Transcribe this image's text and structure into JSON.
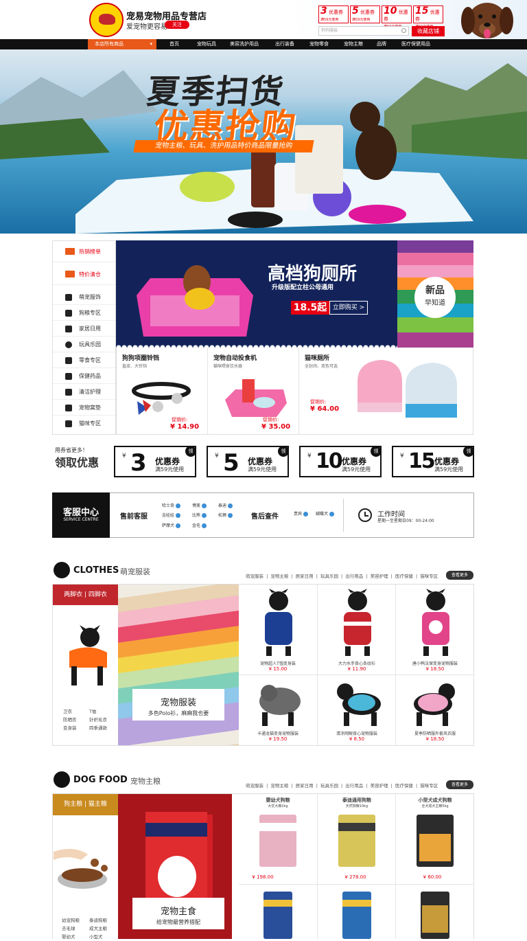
{
  "header": {
    "store_name": "宠易宠物用品专营店",
    "slogan": "爱宠物更容易",
    "follow": "关注",
    "search_placeholder": "狗狗服装",
    "shop_button": "收藏店铺",
    "mini_coupons": [
      {
        "amount": "3",
        "label": "优惠券",
        "cond": "满59元使用"
      },
      {
        "amount": "5",
        "label": "优惠券",
        "cond": "满59元使用"
      },
      {
        "amount": "10",
        "label": "优惠券",
        "cond": "满59元使用"
      },
      {
        "amount": "15",
        "label": "优惠券",
        "cond": "满59元使用"
      }
    ]
  },
  "nav": {
    "all": "本店所有商品",
    "items": [
      "首页",
      "宠物玩具",
      "美容洗护用品",
      "出行装备",
      "宠物零食",
      "宠物主粮",
      "品牌",
      "医疗保健用品"
    ]
  },
  "banner": {
    "title1": "夏季扫货",
    "title2": "优惠抢购",
    "sub": "宠物主粮、玩具、洗护用品特价商品限量抢购"
  },
  "side_menu": [
    {
      "label": "热销榜单",
      "icon": "top-icon"
    },
    {
      "label": "特价清仓",
      "icon": "sale-icon"
    },
    {
      "label": "萌宠服饰",
      "icon": "shirt-icon"
    },
    {
      "label": "狗粮专区",
      "icon": "bone-icon"
    },
    {
      "label": "家居日用",
      "icon": "home-icon"
    },
    {
      "label": "玩具乐园",
      "icon": "ball-icon"
    },
    {
      "label": "零食专区",
      "icon": "snack-icon"
    },
    {
      "label": "保健药品",
      "icon": "medkit-icon"
    },
    {
      "label": "清洁护理",
      "icon": "bottle-icon"
    },
    {
      "label": "宠物窝垫",
      "icon": "bed-icon"
    },
    {
      "label": "猫咪专区",
      "icon": "cat-icon"
    }
  ],
  "promo": {
    "title": "高档狗厕所",
    "sub": "升级版配立柱公母通用",
    "price": "18.5起",
    "buy": "立即购买 >",
    "badge1": "新品",
    "badge2": "早知道"
  },
  "featured": [
    {
      "name": "狗狗项圈铃铛",
      "desc": "直皮、大铃铛",
      "label": "促销价:",
      "price": "¥ 14.90"
    },
    {
      "name": "宠物自动投食机",
      "desc": "猫咪喂食饮水器",
      "label": "促销价:",
      "price": "¥ 35.00"
    },
    {
      "name": "猫咪厕所",
      "desc": "全封闭、双色可选",
      "label": "促销价:",
      "price": "¥ 64.00"
    }
  ],
  "coupons": {
    "title1": "用券省更多！",
    "title2": "领取优惠",
    "items": [
      {
        "yen": "¥",
        "amount": "3",
        "name": "优惠券",
        "cond": "满59元使用",
        "tag": "领"
      },
      {
        "yen": "¥",
        "amount": "5",
        "name": "优惠券",
        "cond": "满59元使用",
        "tag": "领"
      },
      {
        "yen": "¥",
        "amount": "10",
        "name": "优惠券",
        "cond": "满59元使用",
        "tag": "领"
      },
      {
        "yen": "¥",
        "amount": "15",
        "name": "优惠券",
        "cond": "满59元使用",
        "tag": "领"
      }
    ]
  },
  "service": {
    "title": "客服中心",
    "title_en": "SERVICE CENTRE",
    "presale": "售前客服",
    "presale_agents": [
      "哈士奇",
      "博美",
      "泰迪",
      "吉娃娃",
      "比熊",
      "松狮",
      "萨摩犬",
      "金毛"
    ],
    "aftersale": "售后查件",
    "aftersale_agents": [
      "贵宾",
      "蝴蝶犬"
    ],
    "hours_title": "工作时间",
    "hours": "星期一至星期日09：00-24:00"
  },
  "clothes": {
    "title": "CLOTHES",
    "cn": "萌宠服装",
    "links": "萌宠服装 | 宠物主粮 | 居家日用 | 玩具乐园 | 出行用品 | 美容护理 | 医疗保健 | 猫咪专区",
    "more": "查看更多",
    "tab": "两脚衣 | 四脚衣",
    "sublinks": [
      "卫衣",
      "T恤",
      "防晒衣",
      "针织毛衣",
      "变身装",
      "四季通款"
    ],
    "cap_title": "宠物服装",
    "cap_sub": "多色Polo衫，麻麻我也要",
    "products": [
      {
        "name": "宠物超人T恤变身装",
        "price": "¥ 15.00",
        "color": "#1c3f94"
      },
      {
        "name": "大力水手背心条纹衫",
        "price": "¥ 11.90",
        "color": "#c7262e"
      },
      {
        "name": "唐小鸭法保变身宠物服装",
        "price": "¥ 18.50",
        "color": "#e2448a"
      },
      {
        "name": "卡通龙猫变身宠物服装",
        "price": "¥ 19.50",
        "color": "#6a6a6a"
      },
      {
        "name": "清凉网眼背心宠物服装",
        "price": "¥ 8.50",
        "color": "#4bb7d9"
      },
      {
        "name": "夏季防晒服外套风衣服",
        "price": "¥ 18.50",
        "color": "#f1a6c8"
      }
    ]
  },
  "dogfood": {
    "title": "DOG FOOD",
    "cn": "宠物主粮",
    "links": "萌宠服装 | 宠物主粮 | 居家日用 | 玩具乐园 | 出行用品 | 美容护理 | 医疗保健 | 猫咪专区",
    "more": "查看更多",
    "tab": "狗主粮 | 猫主粮",
    "sublinks": [
      "幼宠狗粮",
      "泰迪狗粮",
      "去毛球",
      "成犬主粮",
      "婴幼犬",
      "小型犬"
    ],
    "cap_title": "宠物主食",
    "cap_sub": "给宠物最营养搭配",
    "products": [
      {
        "name": "婴幼犬狗粮",
        "desc": "大优大粮2kg",
        "price": "¥ 198.00",
        "color": "#e8b2c2"
      },
      {
        "name": "泰迪通用狗粮",
        "desc": "天然狗粮10kg",
        "price": "¥ 278.00",
        "color": "#d7c55a"
      },
      {
        "name": "小型犬成犬狗粮",
        "desc": "全犬成犬主粮5kg",
        "price": "¥ 60.00",
        "color": "#e9a43a"
      },
      {
        "name": "",
        "desc": "",
        "price": "",
        "color": "#2a4f9a"
      },
      {
        "name": "",
        "desc": "",
        "price": "",
        "color": "#2b6db5"
      },
      {
        "name": "",
        "desc": "",
        "price": "",
        "color": "#c79a3a"
      }
    ]
  }
}
